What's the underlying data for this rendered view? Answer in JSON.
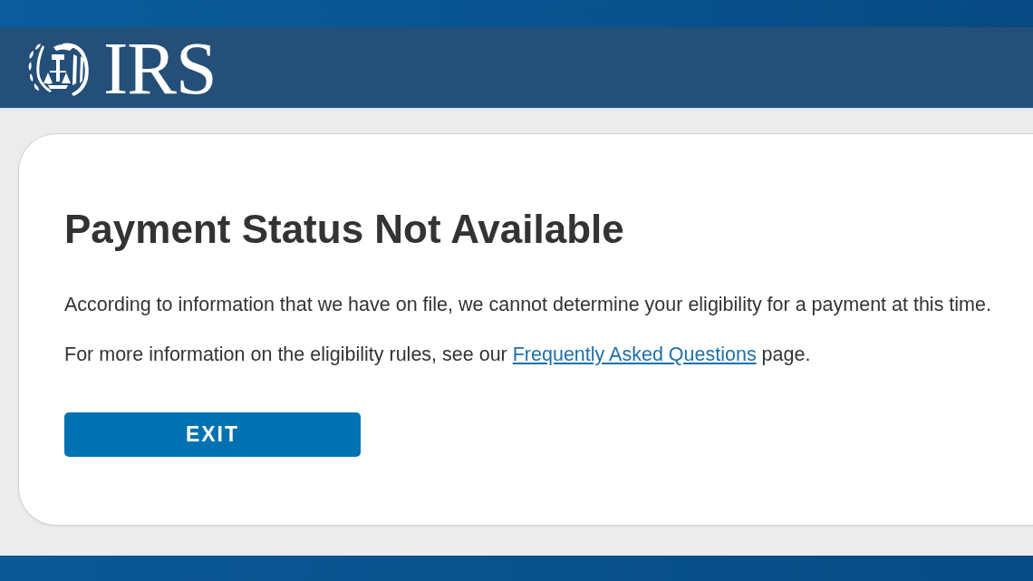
{
  "header": {
    "logo_text": "IRS"
  },
  "card": {
    "title": "Payment Status Not Available",
    "paragraphs": [
      {
        "text": "According to information that we have on file, we cannot determine your eligibility for a payment at this time."
      },
      {
        "text": "For more information on the eligibility rules, see our ",
        "link": "Frequently Asked Questions",
        "text_after": " page."
      }
    ],
    "button": "EXIT"
  }
}
